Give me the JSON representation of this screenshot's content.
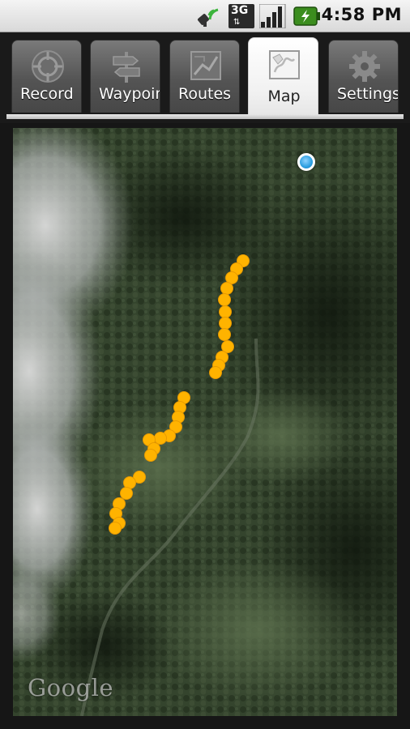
{
  "status_bar": {
    "time": "4:58 PM",
    "icons": [
      "gps-signal-icon",
      "3g-network-icon",
      "signal-strength-icon",
      "battery-charging-icon"
    ],
    "network_label": "3G"
  },
  "tabs": [
    {
      "label": "Record",
      "icon": "record-compass-icon",
      "selected": false
    },
    {
      "label": "Waypoints",
      "icon": "waypoint-signpost-icon",
      "selected": false
    },
    {
      "label": "Routes",
      "icon": "routes-map-icon",
      "selected": false
    },
    {
      "label": "Map",
      "icon": "map-icon",
      "selected": true
    },
    {
      "label": "Settings",
      "icon": "gear-icon",
      "selected": false
    }
  ],
  "map": {
    "attribution": "Google",
    "view": "satellite",
    "track_color": "#ffb300",
    "location_color": "#2b9ee0"
  }
}
